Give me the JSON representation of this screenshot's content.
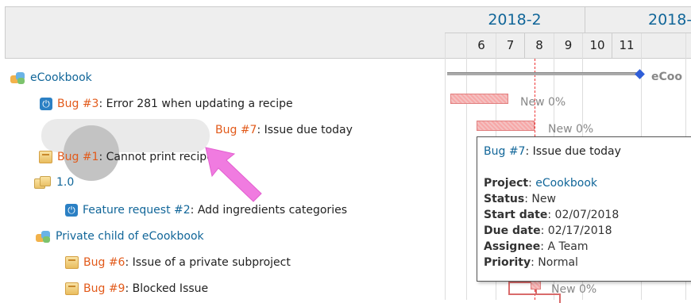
{
  "gantt": {
    "months": [
      "2018-2",
      "2018-"
    ],
    "days": [
      "6",
      "7",
      "8",
      "9",
      "10",
      "11"
    ]
  },
  "subjects": [
    {
      "icon": "project-icon",
      "link": "eCookbook",
      "text": ""
    },
    {
      "icon": "power-icon",
      "tracker": "Bug #3",
      "text": ": Error 281 when updating a recipe"
    },
    {
      "icon": "",
      "tracker": "Bug #7",
      "text": ": Issue due today"
    },
    {
      "icon": "box-icon",
      "tracker": "Bug #1",
      "text": ": Cannot print recipes"
    },
    {
      "icon": "version-icon",
      "link": "1.0",
      "text": ""
    },
    {
      "icon": "power-icon",
      "tracker": "Feature request #2",
      "text": ": Add ingredients categories"
    },
    {
      "icon": "project-icon",
      "link": "Private child of eCookbook",
      "text": ""
    },
    {
      "icon": "box-icon",
      "tracker": "Bug #6",
      "text": ": Issue of a private subproject"
    },
    {
      "icon": "box-icon",
      "tracker": "Bug #9",
      "text": ": Blocked Issue"
    }
  ],
  "bars": {
    "project_label": "eCoo",
    "bug3_label": "New 0%",
    "bug7_label": "New 0%",
    "bug9_label": "New 0%"
  },
  "tooltip": {
    "tracker": "Bug #7",
    "title": ": Issue due today",
    "project_label": "Project",
    "project_value": "eCookbook",
    "status_label": "Status",
    "status_value": "New",
    "start_label": "Start date",
    "start_value": "02/07/2018",
    "due_label": "Due date",
    "due_value": "02/17/2018",
    "assignee_label": "Assignee",
    "assignee_value": "A Team",
    "priority_label": "Priority",
    "priority_value": "Normal"
  },
  "colors": {
    "link": "#116699",
    "bug": "#e25a1a",
    "bar": "#f7a7a7",
    "today_line": "#ee3333",
    "milestone": "#2f5ed8",
    "pointer": "#f07be0"
  }
}
